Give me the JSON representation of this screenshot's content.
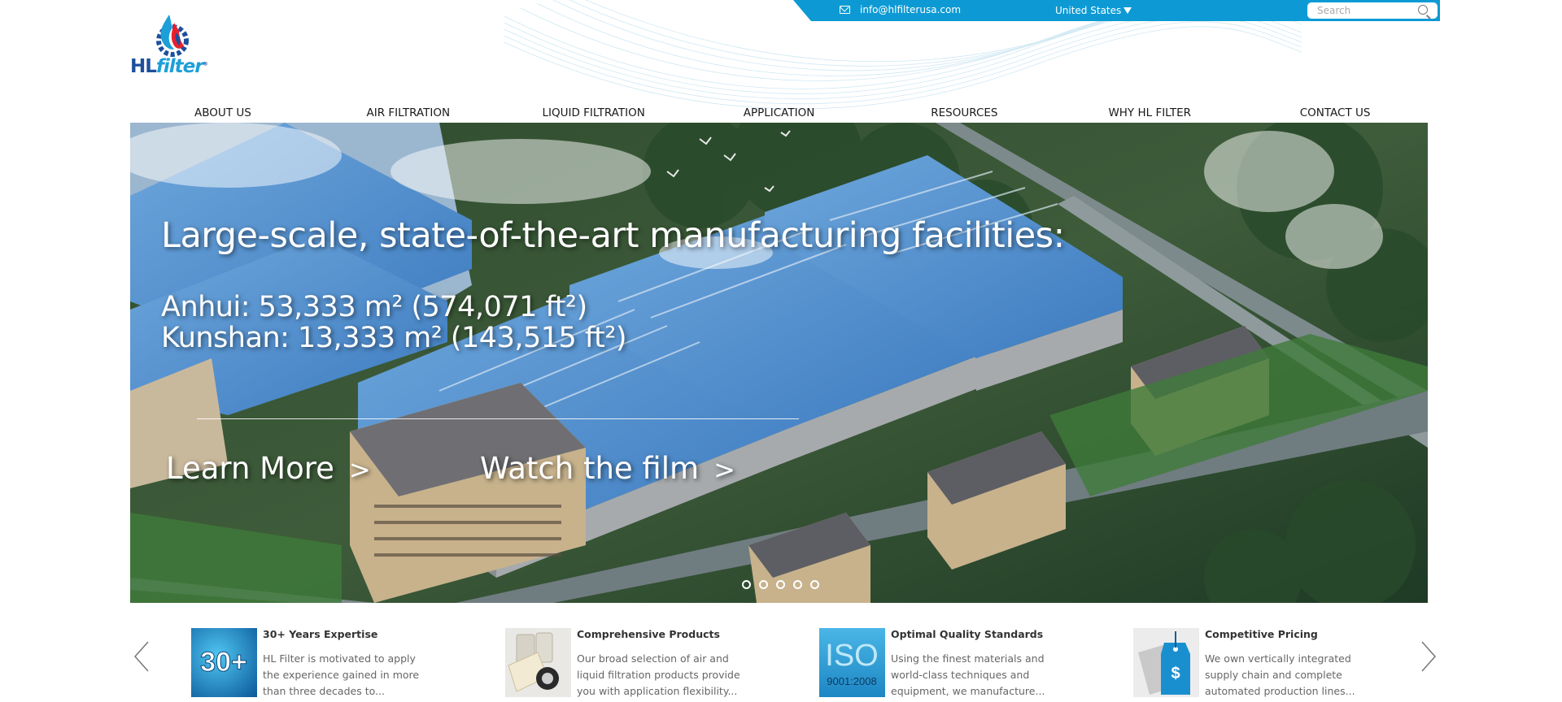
{
  "header": {
    "email": "info@hlfilterusa.com",
    "country": "United States",
    "search_placeholder": "Search",
    "logo": {
      "brand_hl": "HL",
      "brand_filter": "filter",
      "mark": "®"
    }
  },
  "nav": {
    "items": [
      {
        "label": "ABOUT US"
      },
      {
        "label": "AIR FILTRATION"
      },
      {
        "label": "LIQUID FILTRATION"
      },
      {
        "label": "APPLICATION"
      },
      {
        "label": "RESOURCES"
      },
      {
        "label": "WHY HL FILTER"
      },
      {
        "label": "CONTACT US"
      }
    ]
  },
  "hero": {
    "title": "Large-scale, state-of-the-art manufacturing facilities:",
    "line1": "Anhui: 53,333 m² (574,071 ft²)",
    "line2": "Kunshan: 13,333 m² (143,515 ft²)",
    "learn_more": "Learn More",
    "watch_film": "Watch the film",
    "chevron": ">",
    "slide_count": 5
  },
  "features": [
    {
      "title": "30+ Years Expertise",
      "desc": "HL Filter is motivated to apply the experience gained in more than three decades to...",
      "icon": "30-plus-badge",
      "badge": "30+"
    },
    {
      "title": "Comprehensive Products",
      "desc": "Our broad selection of air and liquid filtration products provide you with application flexibility...",
      "icon": "filter-products-photo"
    },
    {
      "title": "Optimal Quality Standards",
      "desc": "Using the finest materials and world-class techniques and equipment, we manufacture...",
      "icon": "iso-badge",
      "badge_top": "ISO",
      "badge_bottom": "9001:2008"
    },
    {
      "title": "Competitive Pricing",
      "desc": "We own vertically integrated supply chain and complete automated production lines...",
      "icon": "price-tag-icon",
      "badge": "$"
    }
  ],
  "colors": {
    "topbar": "#0d9ad4",
    "logo_blue": "#1d4f9c",
    "logo_light_blue": "#1d9fd8",
    "logo_red": "#e8212e"
  }
}
